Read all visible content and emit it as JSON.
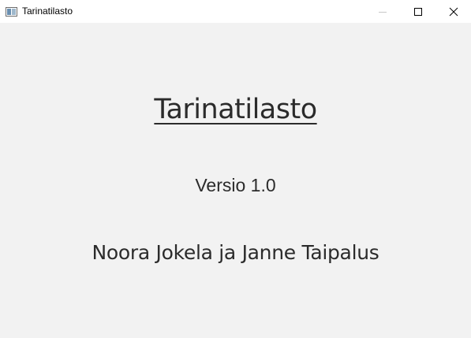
{
  "window": {
    "title": "Tarinatilasto"
  },
  "titlebar_icons": {
    "app": "app-window-icon",
    "minimize": "minimize-icon",
    "maximize": "maximize-icon",
    "close": "close-icon"
  },
  "main": {
    "app_title": "Tarinatilasto",
    "version": "Versio 1.0",
    "authors": "Noora Jokela ja Janne Taipalus"
  }
}
